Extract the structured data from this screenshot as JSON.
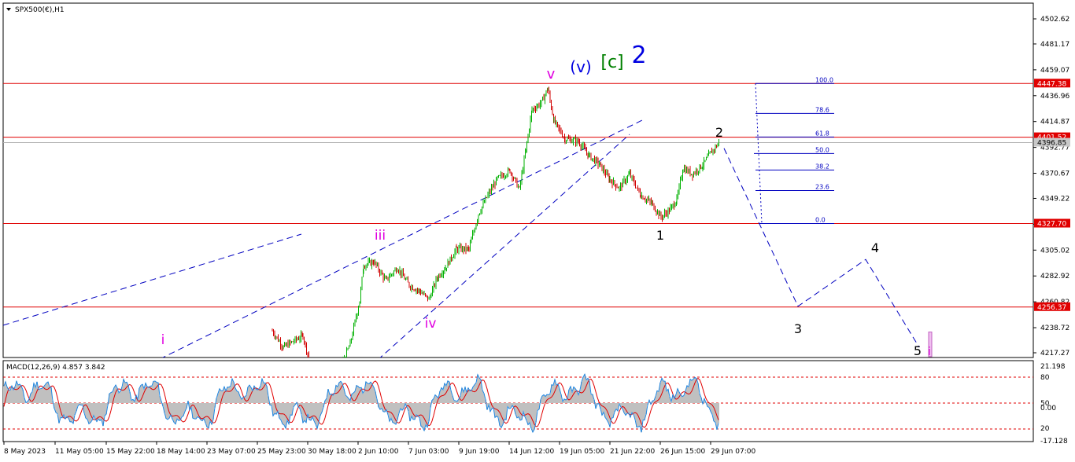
{
  "chart_data": {
    "type": "candlestick",
    "title": "SPX500(€),H1",
    "price_axis": {
      "range": [
        4212,
        4510
      ],
      "ticks": [
        "4502.62",
        "4481.17",
        "4459.07",
        "4436.96",
        "4414.87",
        "4392.77",
        "4370.67",
        "4349.22",
        "4327.12",
        "4305.02",
        "4282.92",
        "4260.82",
        "4238.72",
        "4217.27"
      ]
    },
    "time_axis": {
      "labels": [
        "8 May 2023",
        "11 May 05:00",
        "15 May 22:00",
        "18 May 14:00",
        "23 May 07:00",
        "25 May 23:00",
        "30 May 18:00",
        "2 Jun 10:00",
        "7 Jun 03:00",
        "9 Jun 19:00",
        "14 Jun 12:00",
        "19 Jun 05:00",
        "21 Jun 22:00",
        "26 Jun 15:00",
        "29 Jun 07:00"
      ]
    },
    "price_levels": [
      {
        "price": 4447.38,
        "label": "4447.38",
        "color": "#e00000"
      },
      {
        "price": 4401.52,
        "label": "4401.52",
        "color": "#e00000"
      },
      {
        "price": 4396.85,
        "label": "4396.85",
        "color": "#b0b0b0",
        "current": true
      },
      {
        "price": 4327.7,
        "label": "4327.70",
        "color": "#e00000"
      },
      {
        "price": 4256.37,
        "label": "4256.37",
        "color": "#e00000"
      }
    ],
    "fibonacci": {
      "high": 4447.38,
      "low": 4327.7,
      "levels": [
        "100.0",
        "78.6",
        "61.8",
        "50.0",
        "38.2",
        "23.6",
        "0.0"
      ]
    },
    "wave_labels": [
      {
        "text": "i",
        "color": "#e000e0"
      },
      {
        "text": "iii",
        "color": "#e000e0"
      },
      {
        "text": "iv",
        "color": "#e000e0"
      },
      {
        "text": "v",
        "color": "#e000e0"
      },
      {
        "text": "(v)",
        "color": "#0000e0"
      },
      {
        "text": "[c]",
        "color": "#008000"
      },
      {
        "text": "2",
        "color": "#0000e0"
      },
      {
        "text": "1",
        "color": "#000000"
      },
      {
        "text": "2",
        "color": "#000000"
      },
      {
        "text": "3",
        "color": "#000000"
      },
      {
        "text": "4",
        "color": "#000000"
      },
      {
        "text": "5",
        "color": "#000000"
      },
      {
        "text": "i",
        "color": "#e000e0"
      }
    ],
    "indicator": {
      "title": "MACD(12,26,9) 4.857 3.842",
      "ticks": [
        "21.198",
        "80",
        "50",
        "0.00",
        "20",
        "-17.128"
      ],
      "levels": [
        80,
        50,
        20
      ]
    },
    "colors": {
      "up_candle": "#00b000",
      "down_candle": "#d00000",
      "level": "#e00000",
      "trendline": "#0000c0",
      "projection": "#0000c0",
      "macd_hist": "#c0c0c0",
      "macd_main": "#1e88e5",
      "macd_signal": "#e00000"
    }
  }
}
